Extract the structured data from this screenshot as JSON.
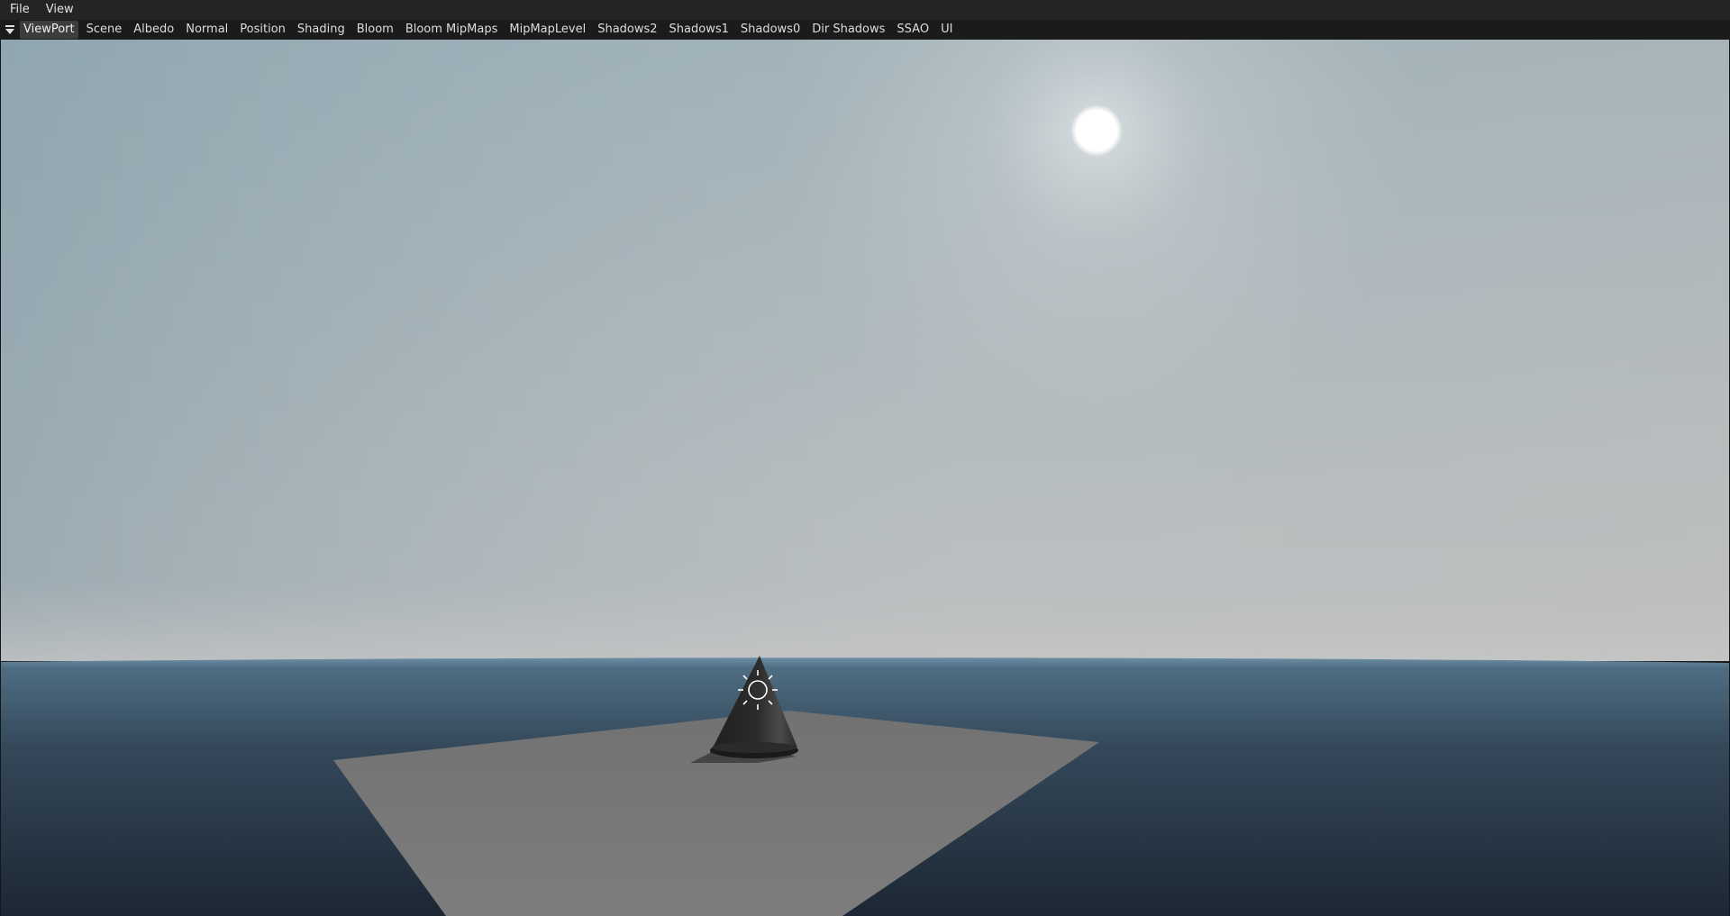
{
  "menubar": {
    "items": [
      {
        "label": "File"
      },
      {
        "label": "View"
      }
    ]
  },
  "tabbar": {
    "dock_icon": "triangle-down-icon",
    "active_tab": "ViewPort",
    "tabs": [
      {
        "label": "ViewPort"
      },
      {
        "label": "Scene"
      },
      {
        "label": "Albedo"
      },
      {
        "label": "Normal"
      },
      {
        "label": "Position"
      },
      {
        "label": "Shading"
      },
      {
        "label": "Bloom"
      },
      {
        "label": "Bloom MipMaps"
      },
      {
        "label": "MipMapLevel"
      },
      {
        "label": "Shadows2"
      },
      {
        "label": "Shadows1"
      },
      {
        "label": "Shadows0"
      },
      {
        "label": "Dir Shadows"
      },
      {
        "label": "SSAO"
      },
      {
        "label": "UI"
      }
    ]
  },
  "viewport": {
    "scene_objects": [
      "sky",
      "sun",
      "ocean",
      "ground-plane",
      "cone",
      "light-gizmo-icon"
    ],
    "colors": {
      "sky_top_left": "#8fa6b0",
      "sky_horizon": "#bfbfbf",
      "ocean_near": "#1f2b38",
      "ocean_far": "#4f6d82",
      "plane": "#7a7a7a",
      "cone": "#262626"
    }
  }
}
